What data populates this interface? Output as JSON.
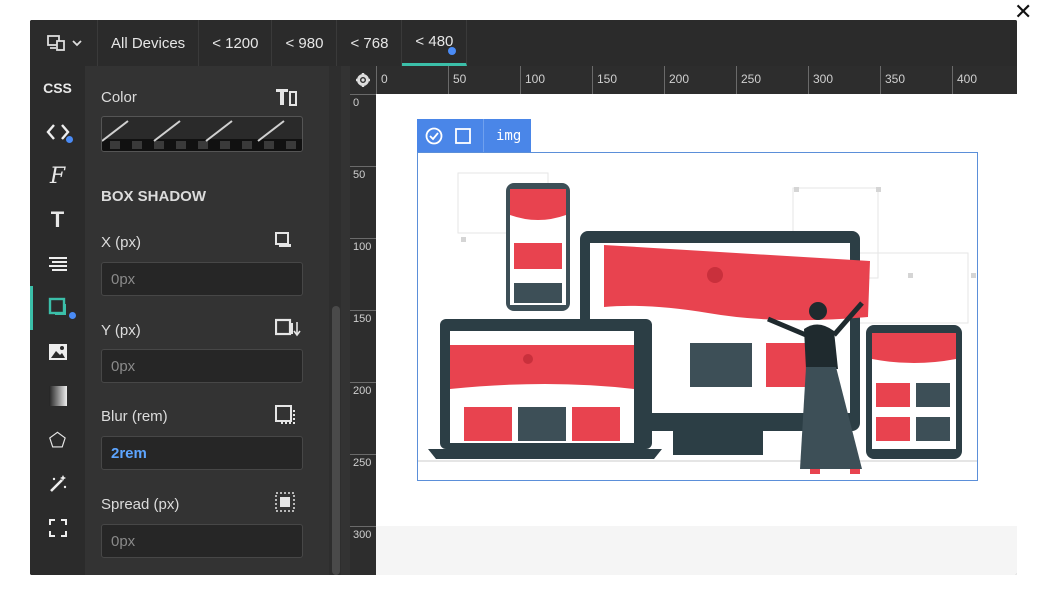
{
  "window": {
    "close_glyph": "✕"
  },
  "device_picker": {
    "icon": "devices-icon",
    "chevron": "chevron-down-icon"
  },
  "tabs": [
    {
      "label": "All Devices"
    },
    {
      "label": "< 1200"
    },
    {
      "label": "< 980"
    },
    {
      "label": "< 768"
    },
    {
      "label": "< 480",
      "active": true
    }
  ],
  "iconbar": [
    {
      "name": "css",
      "label": "CSS"
    },
    {
      "name": "code-icon",
      "label": "<>"
    },
    {
      "name": "font-family-icon",
      "label": "F"
    },
    {
      "name": "text-icon",
      "label": "T"
    },
    {
      "name": "list-icon",
      "label": "≡"
    },
    {
      "name": "box-shadow-icon",
      "label": "",
      "active": true
    },
    {
      "name": "image-icon",
      "label": ""
    },
    {
      "name": "gradient-icon",
      "label": ""
    },
    {
      "name": "shape-icon",
      "label": "⬠"
    },
    {
      "name": "magic-wand-icon",
      "label": ""
    },
    {
      "name": "fullscreen-icon",
      "label": ""
    }
  ],
  "panel": {
    "color_label": "Color",
    "section_title": "BOX SHADOW",
    "x_label": "X (px)",
    "x_placeholder": "0px",
    "y_label": "Y (px)",
    "y_placeholder": "0px",
    "blur_label": "Blur (rem)",
    "blur_value": "2rem",
    "spread_label": "Spread (px)",
    "spread_placeholder": "0px"
  },
  "ruler": {
    "top": [
      "0",
      "50",
      "100",
      "150",
      "200",
      "250",
      "300",
      "350",
      "400"
    ],
    "left": [
      "0",
      "50",
      "100",
      "150",
      "200",
      "250",
      "300"
    ]
  },
  "selection": {
    "tag": "img"
  },
  "colors": {
    "accent": "#3bbfa9",
    "blue": "#4a86e8",
    "red": "#e8434f",
    "slate": "#3d4f57"
  }
}
